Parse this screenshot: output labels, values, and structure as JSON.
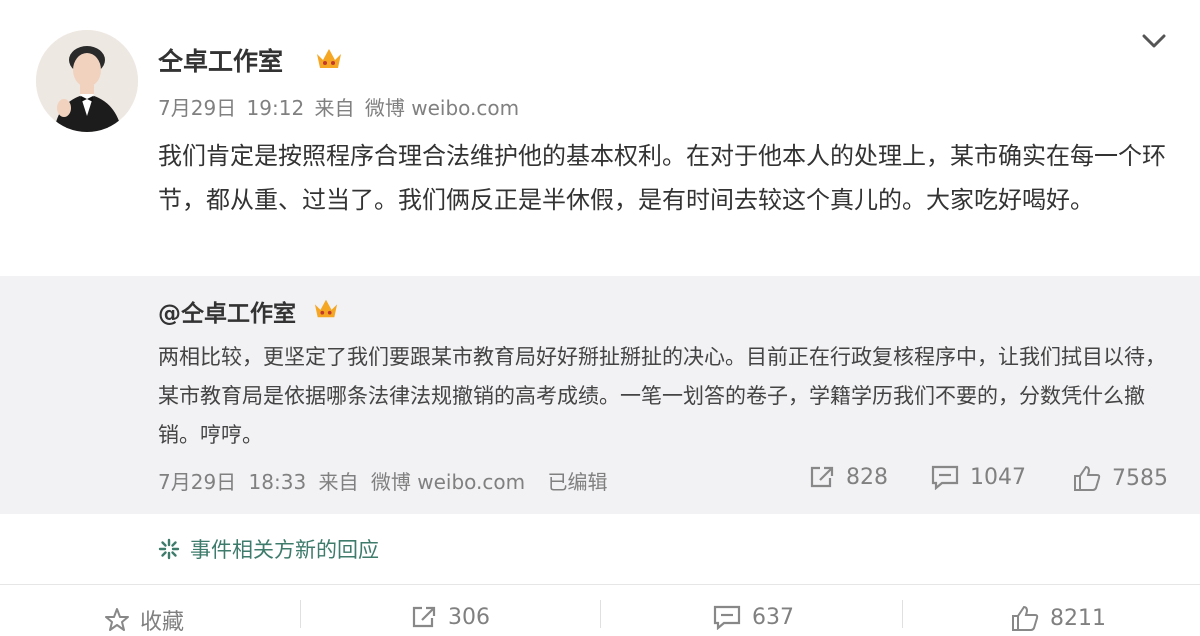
{
  "post": {
    "author": "仝卓工作室",
    "date": "7月29日",
    "time": "19:12",
    "source_prefix": "来自",
    "source": "微博 weibo.com",
    "text": "我们肯定是按照程序合理合法维护他的基本权利。在对于他本人的处理上，某市确实在每一个环节，都从重、过当了。我们俩反正是半休假，是有时间去较这个真儿的。大家吃好喝好。"
  },
  "repost": {
    "author": "@仝卓工作室",
    "text": "两相比较，更坚定了我们要跟某市教育局好好掰扯掰扯的决心。目前正在行政复核程序中，让我们拭目以待，某市教育局是依据哪条法律法规撤销的高考成绩。一笔一划答的卷子，学籍学历我们不要的，分数凭什么撤销。哼哼。",
    "date": "7月29日",
    "time": "18:33",
    "source_prefix": "来自",
    "source": "微博 weibo.com",
    "edited": "已编辑",
    "reposts": "828",
    "comments": "1047",
    "likes": "7585"
  },
  "event_link": "事件相关方新的回应",
  "actions": {
    "favorite": "收藏",
    "reposts": "306",
    "comments": "637",
    "likes": "8211"
  },
  "colors": {
    "repost_bg": "#f2f2f5",
    "meta_gray": "#808080",
    "link_green": "#3e7b6b",
    "badge_orange": "#f5a623"
  }
}
